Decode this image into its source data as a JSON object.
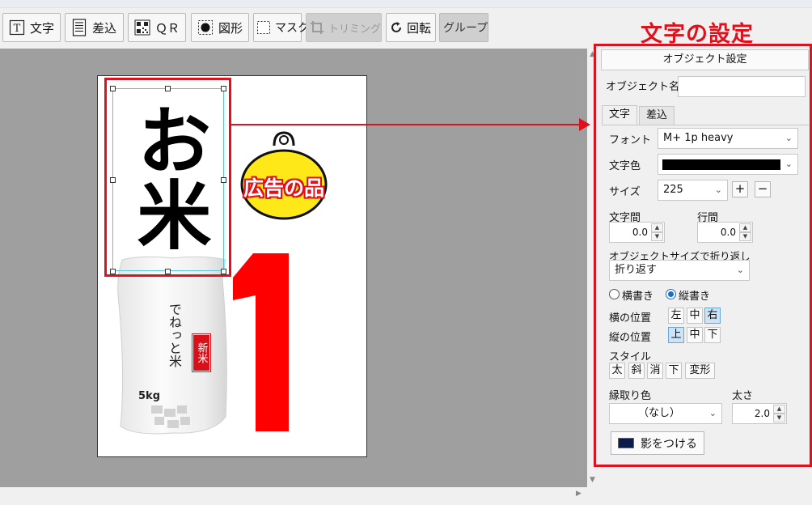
{
  "toolbar": {
    "text_btn": "文字",
    "merge_btn": "差込",
    "qr_btn": "ＱＲ",
    "shape_btn": "図形",
    "mask_btn": "マスク",
    "trim_btn": "トリミング",
    "rotate_btn": "回転",
    "group_btn": "グループ"
  },
  "annotation": {
    "heading": "文字の設定",
    "color": "#e0101c"
  },
  "canvas": {
    "main_text": "お米",
    "badge_text": "広告の品",
    "big_number": "1",
    "bag_text": "でねっと米",
    "bag_weight": "5kg",
    "bag_label": "新米"
  },
  "panel": {
    "caption": "オブジェクト設定",
    "object_name_label": "オブジェクト名",
    "object_name_value": "",
    "tabs": [
      "文字",
      "差込"
    ],
    "font_label": "フォント",
    "font_value": "M+ 1p heavy",
    "color_label": "文字色",
    "color_value": "#000000",
    "size_label": "サイズ",
    "size_value": "225",
    "plus": "+",
    "minus": "−",
    "char_spacing_label": "文字間",
    "char_spacing_value": "0.0",
    "line_spacing_label": "行間",
    "line_spacing_value": "0.0",
    "wrap_label": "オブジェクトサイズで折り返し",
    "wrap_value": "折り返す",
    "horizontal_label": "横書き",
    "vertical_label": "縦書き",
    "writing_mode": "vertical",
    "h_align_label": "横の位置",
    "h_align_options": [
      "左",
      "中",
      "右"
    ],
    "h_align_selected": "右",
    "v_align_label": "縦の位置",
    "v_align_options": [
      "上",
      "中",
      "下"
    ],
    "v_align_selected": "上",
    "style_label": "スタイル",
    "style_options": [
      "太",
      "斜",
      "消",
      "下",
      "変形"
    ],
    "outline_label": "縁取り色",
    "outline_value": "（なし）",
    "thickness_label": "太さ",
    "thickness_value": "2.0",
    "shadow_btn": "影をつける",
    "shadow_color": "#0d1b4a"
  }
}
